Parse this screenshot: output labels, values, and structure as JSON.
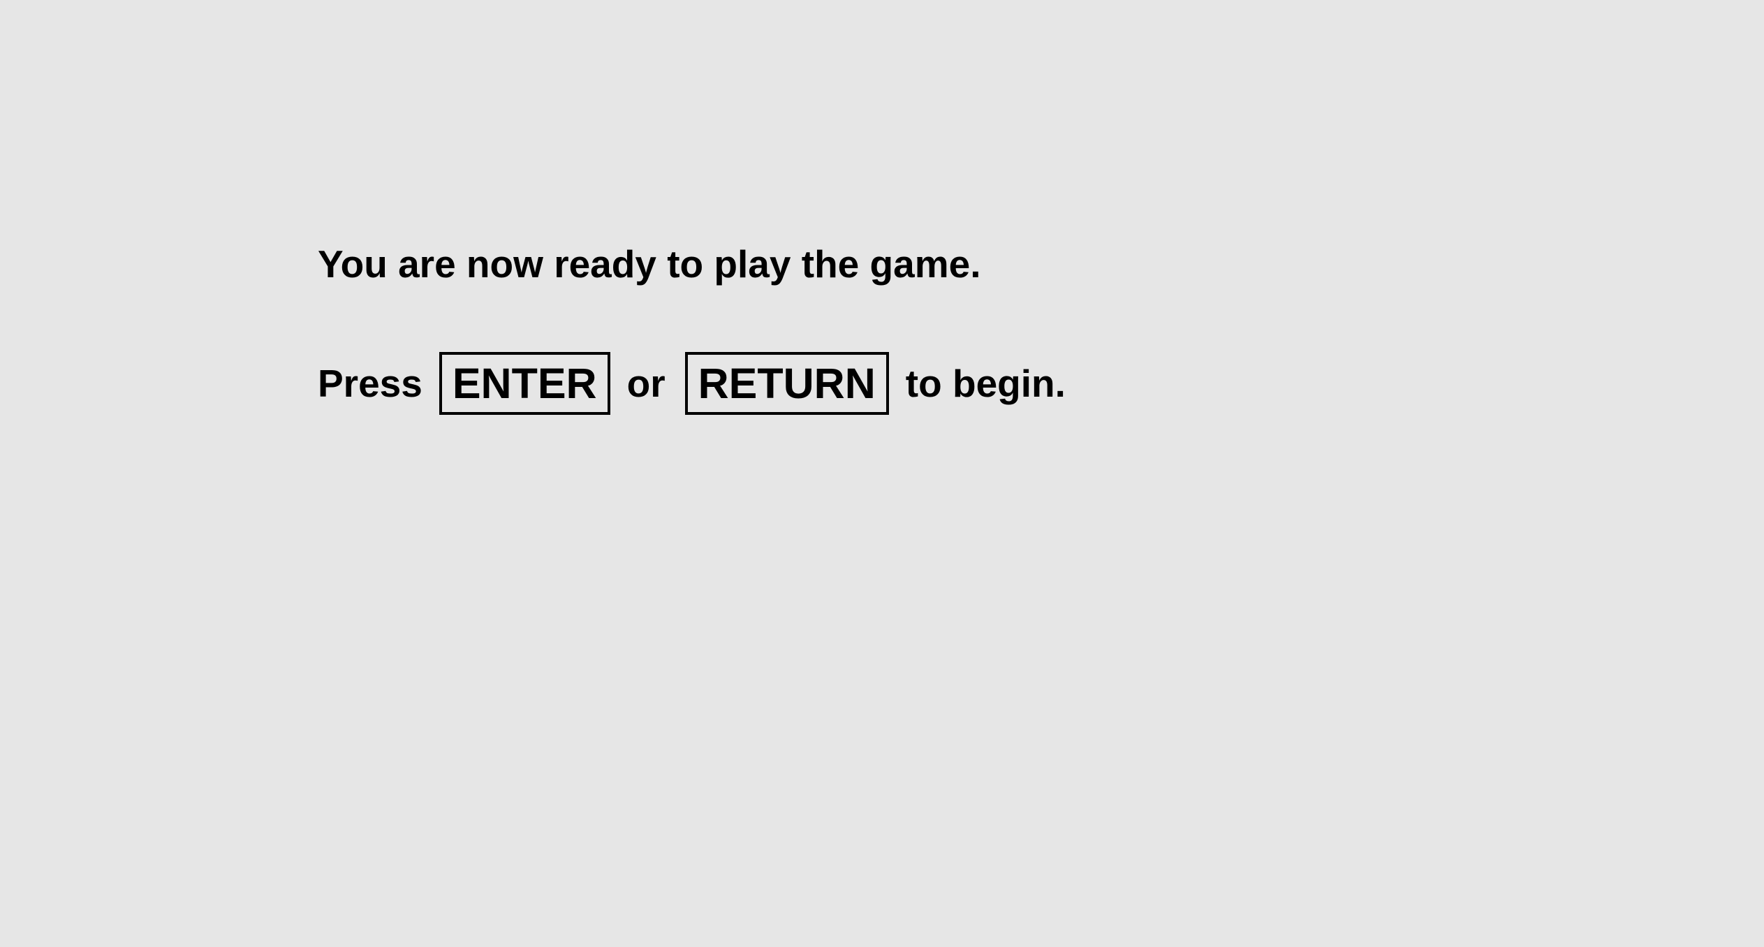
{
  "instructions": {
    "ready_text": "You are now ready to play the game.",
    "press_text": "Press",
    "key_enter": "ENTER",
    "or_text": "or",
    "key_return": "RETURN",
    "begin_text": "to begin."
  },
  "colors": {
    "background": "#e6e6e6",
    "text": "#000000"
  }
}
